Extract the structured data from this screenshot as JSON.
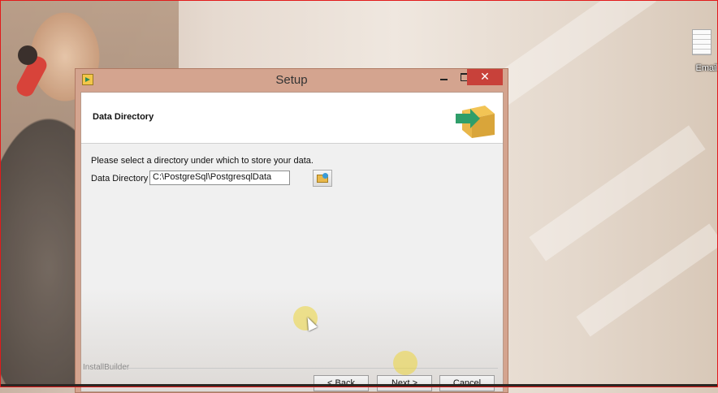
{
  "desktop": {
    "icon_label": "Email"
  },
  "window": {
    "title": "Setup",
    "close_glyph": "✕"
  },
  "page": {
    "heading": "Data Directory",
    "instruction": "Please select a directory under which to store your data.",
    "field_label": "Data Directory",
    "field_value": "C:\\PostgreSql\\PostgresqlData"
  },
  "footer": {
    "brand": "InstallBuilder",
    "back_label": "< Back",
    "next_label": "Next >",
    "cancel_label": "Cancel"
  },
  "colors": {
    "close_button": "#c8413a",
    "window_frame": "#d4a48f",
    "cursor_highlight": "#ecd63c"
  },
  "icons": [
    "app-icon",
    "minimize-icon",
    "maximize-icon",
    "close-icon",
    "installer-box-icon",
    "browse-folder-icon",
    "notepad-file-icon"
  ]
}
